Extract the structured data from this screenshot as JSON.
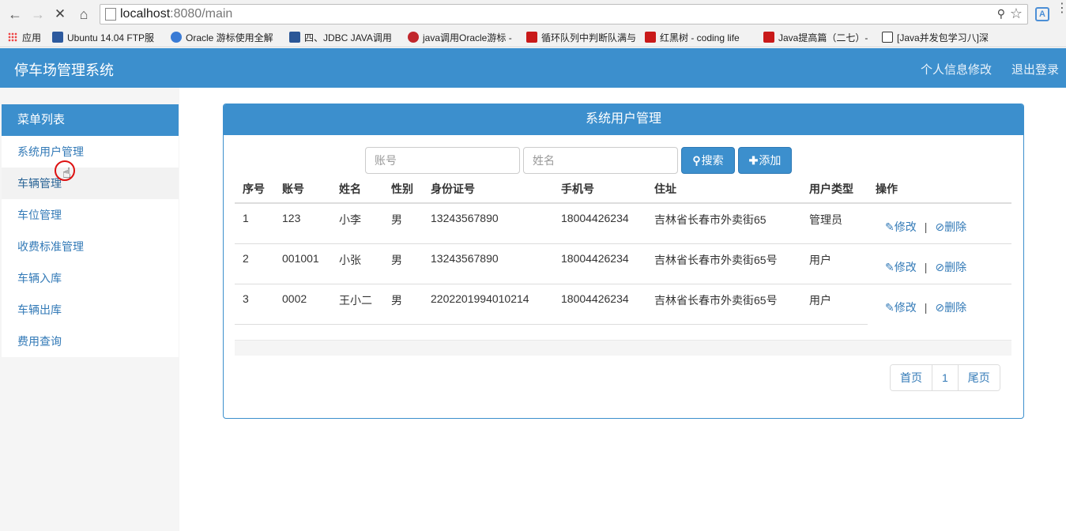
{
  "browser": {
    "url_host": "localhost",
    "url_path": ":8080/main",
    "bookmarks": [
      {
        "label": "应用",
        "color": "#e04a3f"
      },
      {
        "label": "Ubuntu 14.04 FTP服",
        "color": "#2d5a9e"
      },
      {
        "label": "Oracle 游标使用全解",
        "color": "#3a7bd5"
      },
      {
        "label": "四、JDBC JAVA调用",
        "color": "#2b5797"
      },
      {
        "label": "java调用Oracle游标 -",
        "color": "#c1272d"
      },
      {
        "label": "循环队列中判断队满与",
        "color": "#c91a1a"
      },
      {
        "label": "红黑树 - coding life",
        "color": "#c91a1a"
      },
      {
        "label": "Java提高篇（二七）-",
        "color": "#c91a1a"
      },
      {
        "label": "[Java并发包学习八]深",
        "color": "#333333"
      }
    ]
  },
  "header": {
    "brand": "停车场管理系统",
    "profile_link": "个人信息修改",
    "logout_link": "退出登录"
  },
  "sidebar": {
    "heading": "菜单列表",
    "items": [
      {
        "label": "系统用户管理"
      },
      {
        "label": "车辆管理"
      },
      {
        "label": "车位管理"
      },
      {
        "label": "收费标准管理"
      },
      {
        "label": "车辆入库"
      },
      {
        "label": "车辆出库"
      },
      {
        "label": "费用查询"
      }
    ]
  },
  "panel": {
    "title": "系统用户管理",
    "search": {
      "account_placeholder": "账号",
      "name_placeholder": "姓名",
      "search_label": "搜索",
      "add_label": "添加"
    },
    "table": {
      "headers": [
        "序号",
        "账号",
        "姓名",
        "性别",
        "身份证号",
        "手机号",
        "住址",
        "用户类型",
        "操作"
      ],
      "rows": [
        {
          "no": "1",
          "account": "123",
          "name": "小李",
          "gender": "男",
          "id_card": "13243567890",
          "phone": "18004426234",
          "address": "吉林省长春市外卖街65",
          "type": "管理员"
        },
        {
          "no": "2",
          "account": "001001",
          "name": "小张",
          "gender": "男",
          "id_card": "13243567890",
          "phone": "18004426234",
          "address": "吉林省长春市外卖街65号",
          "type": "用户"
        },
        {
          "no": "3",
          "account": "0002",
          "name": "王小二",
          "gender": "男",
          "id_card": "2202201994010214",
          "phone": "18004426234",
          "address": "吉林省长春市外卖街65号",
          "type": "用户"
        }
      ],
      "edit_label": "修改",
      "delete_label": "删除",
      "separator": "|"
    },
    "pagination": {
      "first": "首页",
      "current": "1",
      "last": "尾页"
    }
  },
  "colors": {
    "primary": "#3c8fcd",
    "link": "#337ab7"
  }
}
